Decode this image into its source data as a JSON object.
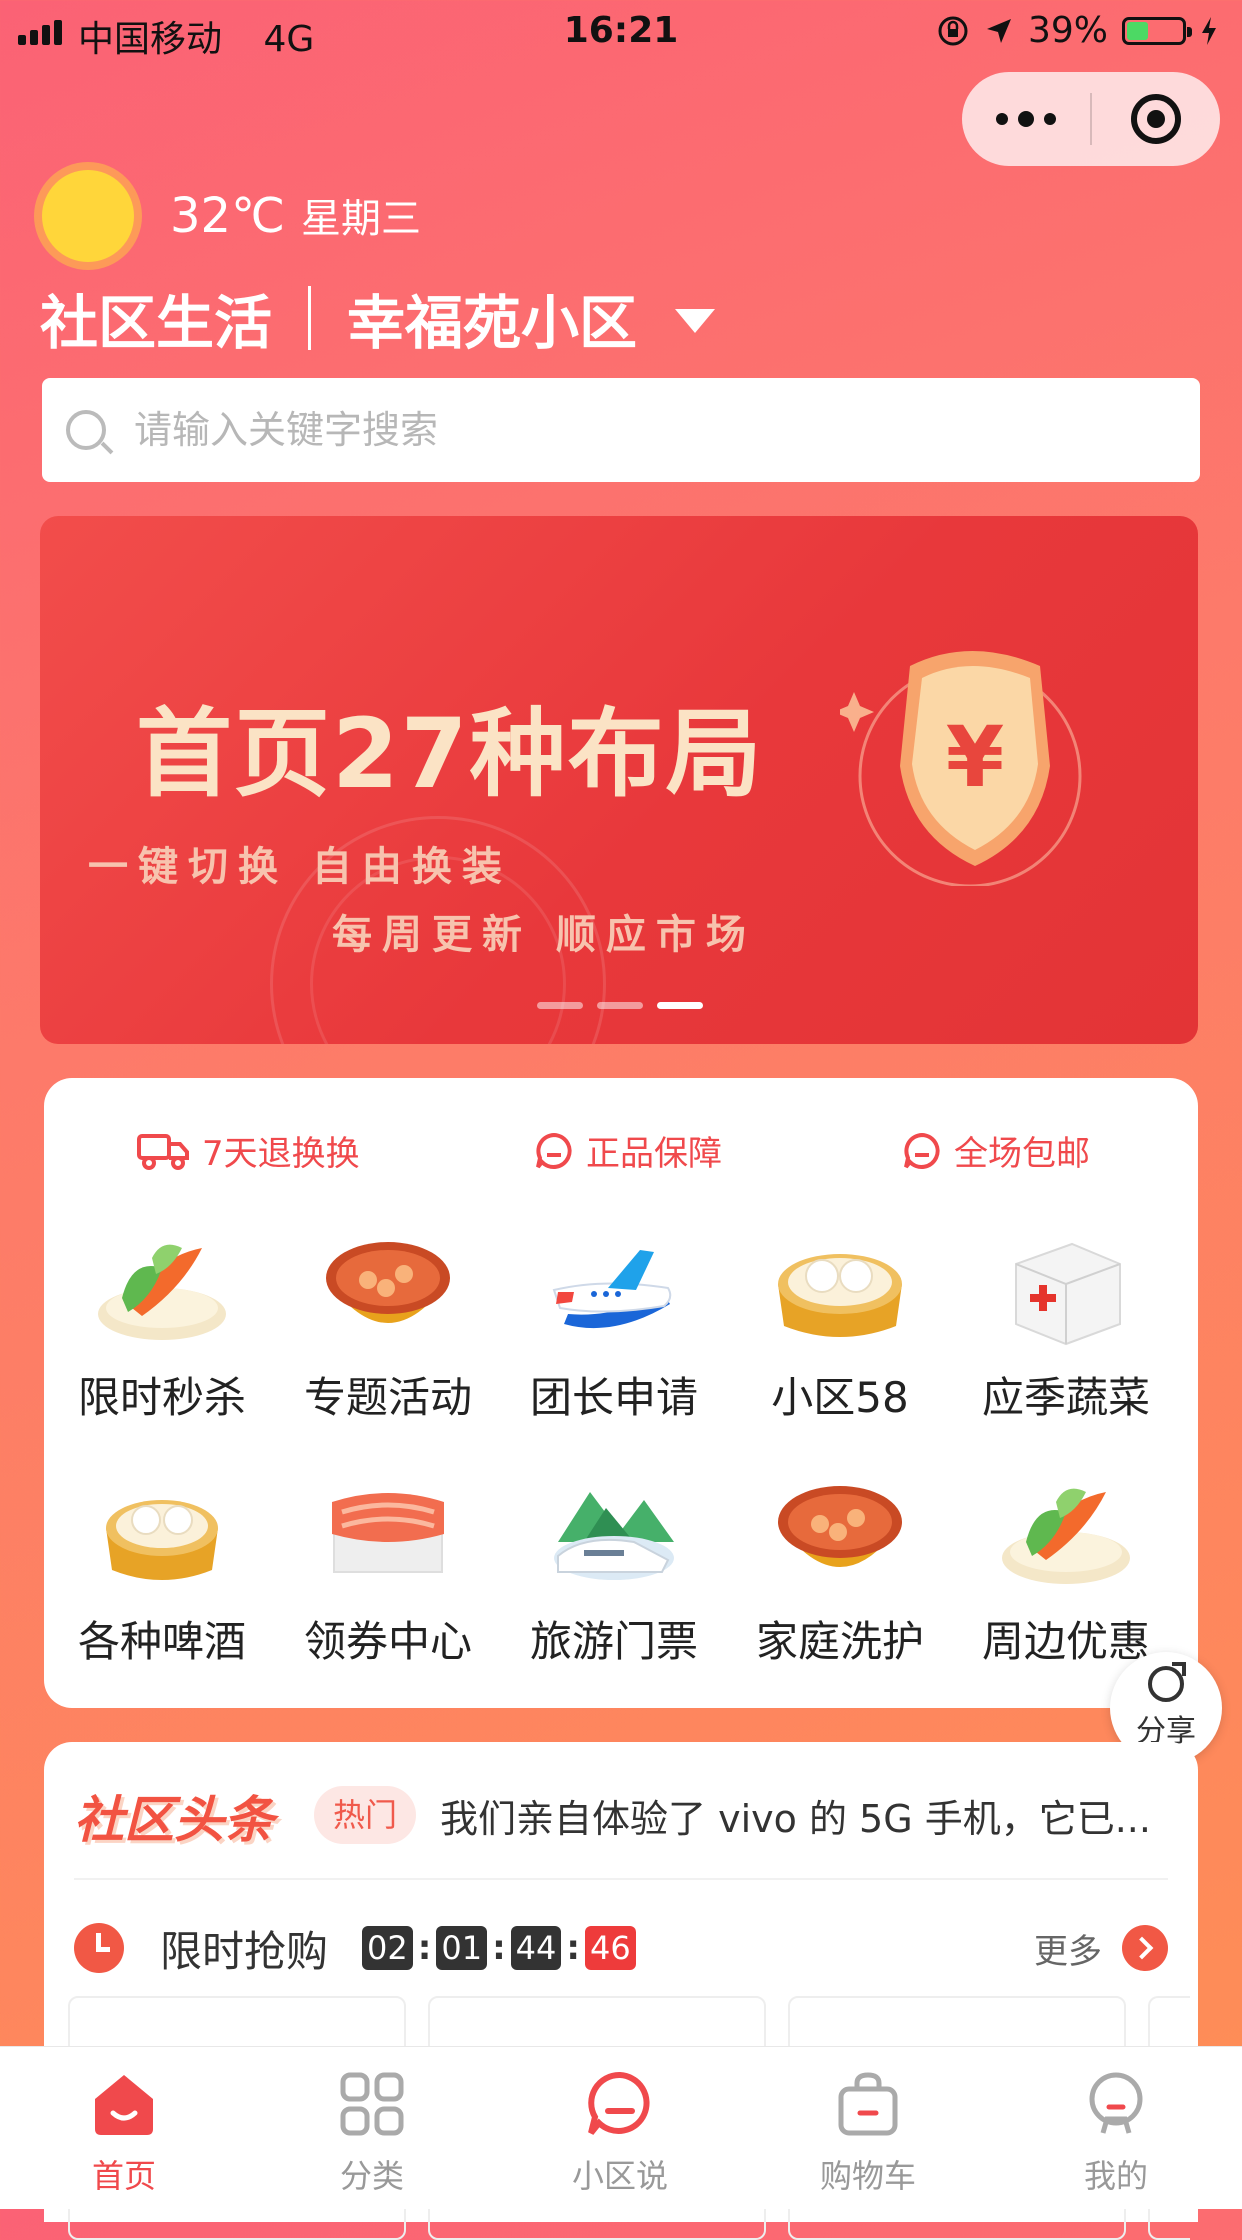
{
  "status_bar": {
    "carrier": "中国移动",
    "network": "4G",
    "time": "16:21",
    "battery": "39%",
    "battery_level": 0.39
  },
  "weather": {
    "temperature": "32℃",
    "weekday": "星期三"
  },
  "header": {
    "title": "社区生活",
    "community": "幸福苑小区"
  },
  "search": {
    "placeholder": "请输入关键字搜索"
  },
  "banner": {
    "headline": "首页27种布局",
    "subline1": "一键切换  自由换装",
    "subline2": "每周更新  顺应市场",
    "shield_symbol": "¥",
    "slide_count": 3,
    "active_slide": 3
  },
  "guarantees": [
    "7天退换换",
    "正品保障",
    "全场包邮"
  ],
  "grid_items": [
    {
      "label": "限时秒杀",
      "icon": "vegetable-plate-icon"
    },
    {
      "label": "专题活动",
      "icon": "hotpot-bowl-icon"
    },
    {
      "label": "团长申请",
      "icon": "airplane-icon"
    },
    {
      "label": "小区58",
      "icon": "steamed-buns-icon"
    },
    {
      "label": "应季蔬菜",
      "icon": "first-aid-kit-icon"
    },
    {
      "label": "各种啤酒",
      "icon": "steamed-buns-icon"
    },
    {
      "label": "领券中心",
      "icon": "sushi-icon"
    },
    {
      "label": "旅游门票",
      "icon": "train-icon"
    },
    {
      "label": "家庭洗护",
      "icon": "hotpot-bowl-icon"
    },
    {
      "label": "周边优惠",
      "icon": "vegetable-plate-icon"
    }
  ],
  "share": {
    "label": "分享"
  },
  "news": {
    "title": "社区头条",
    "hot_tag": "热门",
    "headline": "我们亲自体验了 vivo 的 5G 手机，它已..."
  },
  "flash_sale": {
    "title": "限时抢购",
    "countdown": [
      "02",
      "01",
      "44",
      "46"
    ],
    "more": "更多"
  },
  "tabs": [
    {
      "label": "首页",
      "icon": "home-icon",
      "active": true
    },
    {
      "label": "分类",
      "icon": "grid-icon",
      "active": false
    },
    {
      "label": "小区说",
      "icon": "chat-bubble-icon",
      "active": false
    },
    {
      "label": "购物车",
      "icon": "shopping-bag-icon",
      "active": false
    },
    {
      "label": "我的",
      "icon": "user-icon",
      "active": false
    }
  ],
  "colors": {
    "accent": "#f0494c",
    "background_top": "#fb6275",
    "background_bottom": "#fe8f55"
  }
}
